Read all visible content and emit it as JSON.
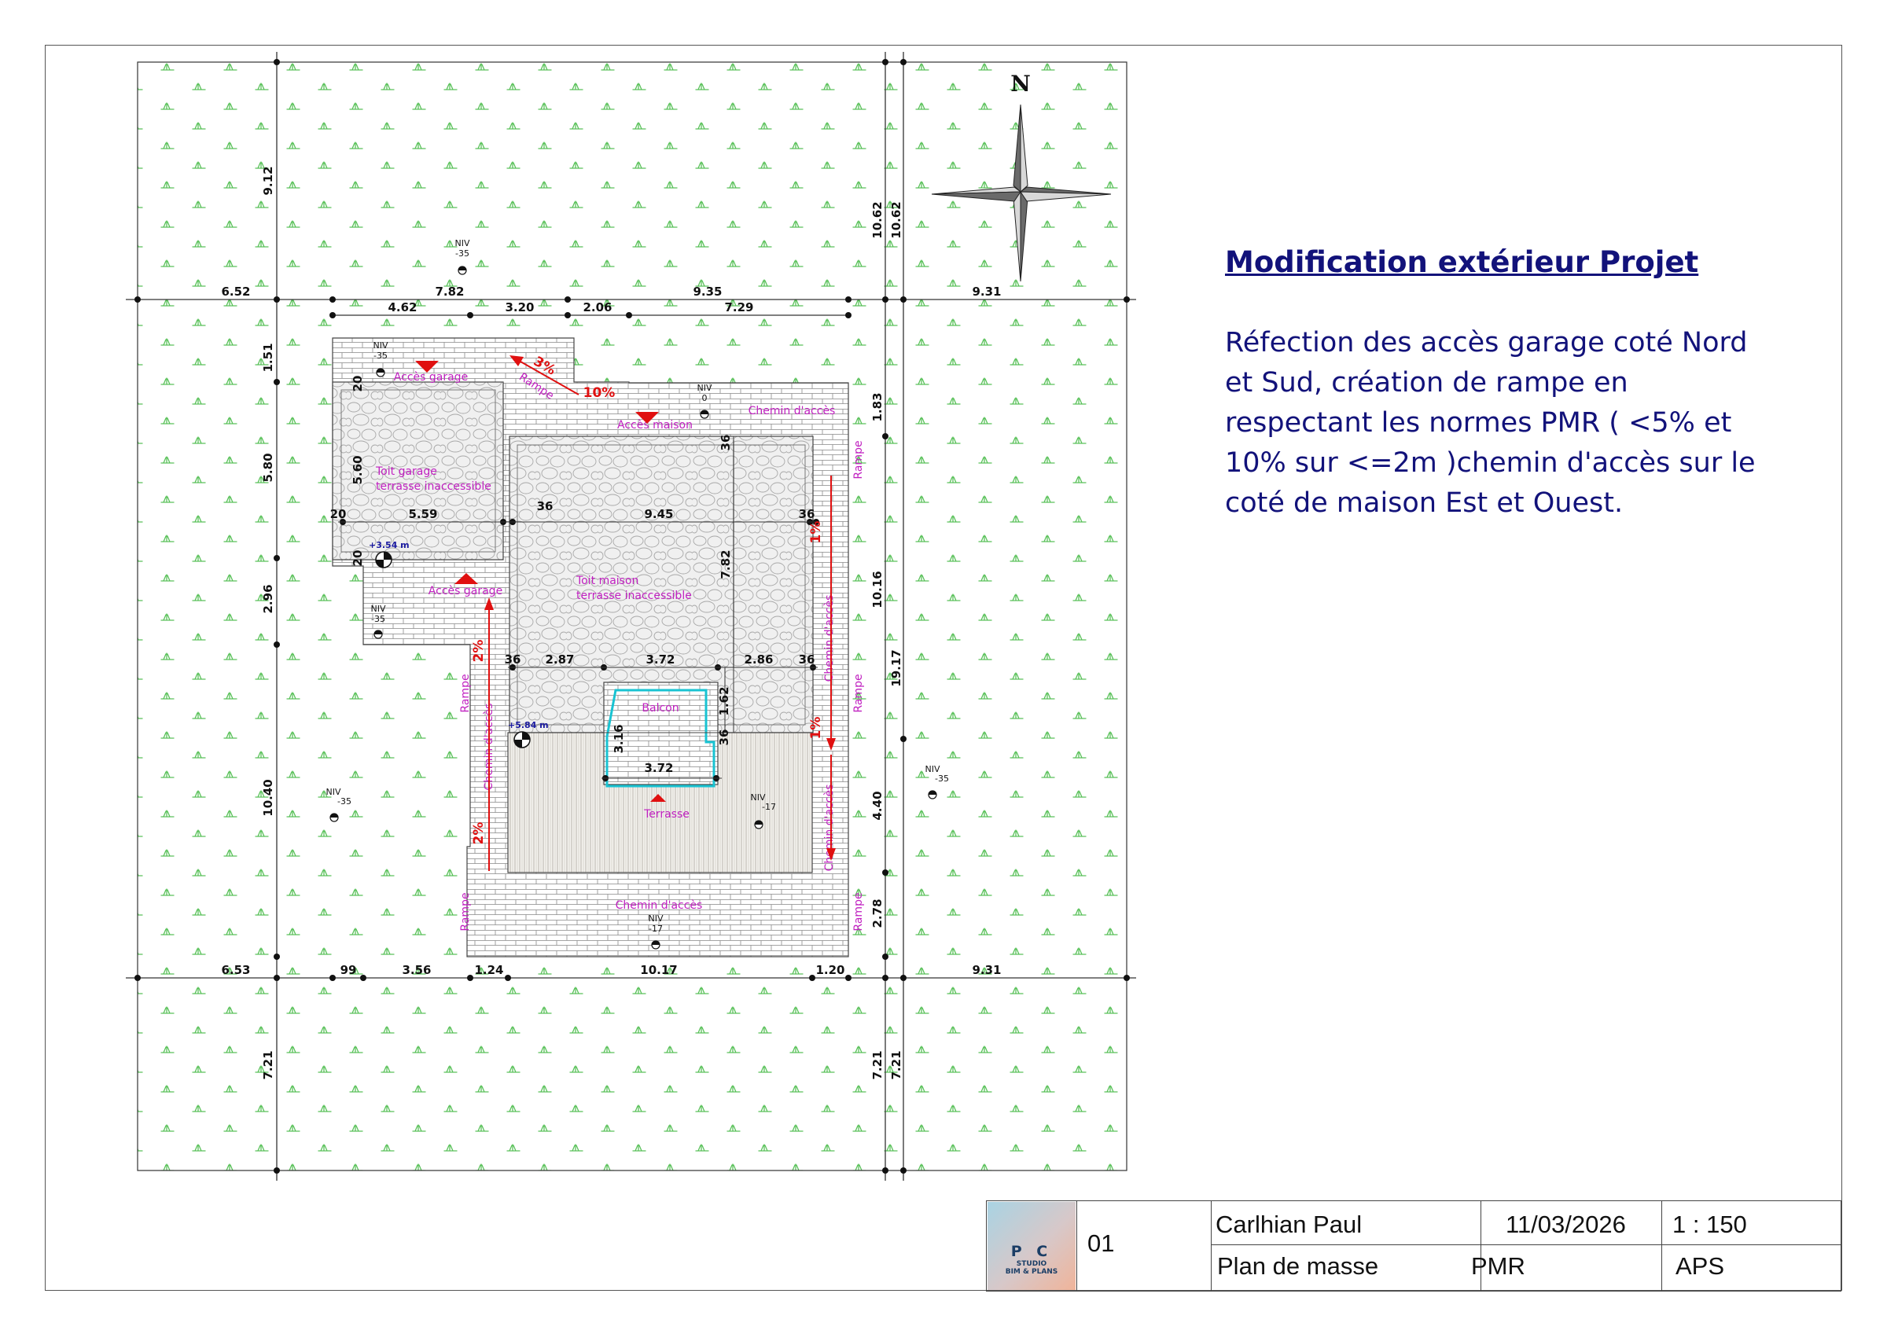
{
  "compass": {
    "north_label": "N"
  },
  "notes": {
    "title": "Modification extérieur Projet",
    "body": "Réfection des accès garage coté Nord et Sud, création de rampe en respectant les normes PMR ( <5% et 10% sur <=2m )chemin d'accès sur le coté de maison Est et Ouest."
  },
  "cartouche": {
    "logo_text": "P C",
    "logo_sub": "STUDIO",
    "logo_sub2": "BIM & PLANS",
    "sheet_number": "01",
    "author": "Carlhian Paul",
    "date": "11/03/2026",
    "scale": "1 : 150",
    "drawing_title": "Plan de masse",
    "subject": "PMR",
    "phase": "APS"
  },
  "labels": {
    "roof_garage_1": "Toit garage",
    "roof_garage_2": "terrasse inaccessible",
    "roof_house_1": "Toit maison",
    "roof_house_2": "terrasse inaccessible",
    "acces_garage_north": "Accès garage",
    "acces_garage_south": "Accès garage",
    "acces_maison": "Accès maison",
    "chemin_north": "Chemin d'accès",
    "chemin_south": "Chemin d'accès",
    "chemin_west": "Chemin d'accès",
    "chemin_east_1": "Chemin d'accès",
    "chemin_east_2": "Chemin d'accès",
    "balcon": "Balcon",
    "terrasse": "Terrasse",
    "rampe_diag": "Rampe",
    "rampe_w1": "Rampe",
    "rampe_w2": "Rampe",
    "rampe_e1": "Rampe",
    "rampe_e2": "Rampe",
    "rampe_e3": "Rampe"
  },
  "slopes": {
    "s3": "3%",
    "s10": "10%",
    "s1a": "1%",
    "s1b": "1%",
    "s2a": "2%",
    "s2b": "2%"
  },
  "levels": {
    "tag": "NIV",
    "n35a": "-35",
    "n35b": "-35",
    "n35c": "-35",
    "n35d": "-35",
    "n35e": "-35",
    "n0": "0",
    "n17a": "-17",
    "n17b": "-17",
    "h354": "+3.54 m",
    "h584": "+5.84 m"
  },
  "dims": {
    "top_6_52": "6.52",
    "top_7_82": "7.82",
    "top_9_35": "9.35",
    "top_9_31": "9.31",
    "top_4_62": "4.62",
    "top_3_20": "3.20",
    "top_2_06": "2.06",
    "top_7_29": "7.29",
    "bot_6_53": "6.53",
    "bot_99": "99",
    "bot_3_56": "3.56",
    "bot_1_24": "1.24",
    "bot_10_17": "10.17",
    "bot_1_20": "1.20",
    "bot_9_31": "9.31",
    "l_9_12": "9.12",
    "l_1_51": "1.51",
    "l_5_80": "5.80",
    "l_2_96": "2.96",
    "l_10_40": "10.40",
    "l_7_21": "7.21",
    "r_10_62a": "10.62",
    "r_10_62b": "10.62",
    "r_1_83": "1.83",
    "r_10_16": "10.16",
    "r_19_17": "19.17",
    "r_4_40": "4.40",
    "r_2_78": "2.78",
    "r_7_21a": "7.21",
    "r_7_21b": "7.21",
    "g_5_60": "5.60",
    "g_5_59": "5.59",
    "g_20a": "20",
    "g_20b": "20",
    "g_20c": "20",
    "h_36a": "36",
    "h_36b": "36",
    "h_36c": "36",
    "h_36d": "36",
    "h_36e": "36",
    "h_36f": "36",
    "h_9_45": "9.45",
    "h_7_82": "7.82",
    "h_2_87": "2.87",
    "h_3_72a": "3.72",
    "h_2_86": "2.86",
    "h_1_62": "1.62",
    "b_3_16": "3.16",
    "b_3_72": "3.72"
  },
  "colors": {
    "grass": "#59c159",
    "title": "#12127a",
    "annotation": "#c020c0",
    "slope": "#e01010",
    "balcony_outline": "#19c3d2",
    "level_blue": "#1a1aa0",
    "frame": "#555555"
  }
}
